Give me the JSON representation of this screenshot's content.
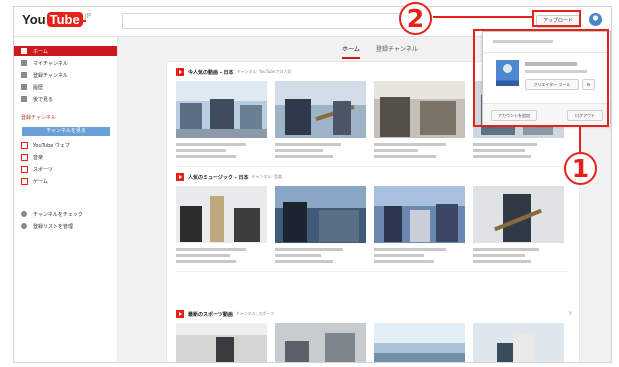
{
  "browser": {
    "logo_you": "You",
    "logo_tube": "Tube",
    "logo_suffix": "JP",
    "upload_label": "アップロード"
  },
  "sidebar": {
    "items": [
      {
        "label": "ホーム",
        "active": true
      },
      {
        "label": "マイチャンネル",
        "active": false
      },
      {
        "label": "登録チャンネル",
        "active": false
      },
      {
        "label": "履歴",
        "active": false
      },
      {
        "label": "後で見る",
        "active": false
      }
    ],
    "section_title": "登録チャンネル",
    "browse_label": "チャンネルを見る",
    "channels": [
      "YouTube ウェブ",
      "音楽",
      "スポーツ",
      "ゲーム"
    ],
    "bottom": [
      "チャンネルをチェック",
      "登録リストを管理"
    ]
  },
  "main": {
    "tabs": [
      "ホーム",
      "登録チャンネル"
    ]
  },
  "shelves": [
    {
      "title": "今人気の動画 - 日本",
      "subtitle": "チャンネル: YouTubeでの人気"
    },
    {
      "title": "人気のミュージック - 日本",
      "subtitle": "チャンネル: 音楽"
    },
    {
      "title": "最新のスポーツ動画",
      "subtitle": "チャンネル: スポーツ"
    }
  ],
  "popup": {
    "creator_studio": "クリエイター ツール",
    "add_account": "アカウントを追加",
    "sign_out": "ログアウト"
  },
  "callouts": {
    "one": "1",
    "two": "2"
  },
  "colors": {
    "accent": "#e62117",
    "sidebar_active": "#cc181e",
    "browse_button": "#6aa0d8"
  }
}
